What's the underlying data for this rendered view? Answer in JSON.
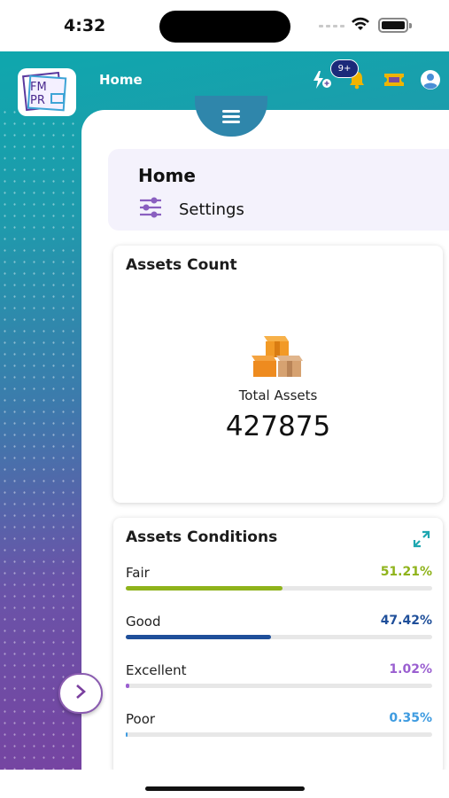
{
  "status_bar": {
    "time": "4:32"
  },
  "header": {
    "title": "Home",
    "notification_badge": "9+",
    "logo_text": "FM PRO"
  },
  "breadcrumb": {
    "title": "Home",
    "settings_label": "Settings"
  },
  "assets_count": {
    "title": "Assets Count",
    "total_label": "Total Assets",
    "total_value": "427875"
  },
  "assets_conditions": {
    "title": "Assets Conditions",
    "items": [
      {
        "label": "Fair",
        "percent_text": "51.21%",
        "fraction": 0.5121,
        "color": "#8fb31b"
      },
      {
        "label": "Good",
        "percent_text": "47.42%",
        "fraction": 0.4742,
        "color": "#1f4f9a"
      },
      {
        "label": "Excellent",
        "percent_text": "1.02%",
        "fraction": 0.0102,
        "color": "#9a5fd0"
      },
      {
        "label": "Poor",
        "percent_text": "0.35%",
        "fraction": 0.0035,
        "color": "#3e9be0"
      }
    ]
  },
  "colors": {
    "teal": "#0fa7ad",
    "purple": "#7a3f9f",
    "accent_gold": "#f0b400"
  },
  "icons": [
    "wifi-icon",
    "battery-icon",
    "flash-add-icon",
    "bell-icon",
    "ticket-icon",
    "user-icon",
    "menu-icon",
    "sliders-icon",
    "boxes-icon",
    "expand-icon",
    "chevron-right-icon"
  ]
}
